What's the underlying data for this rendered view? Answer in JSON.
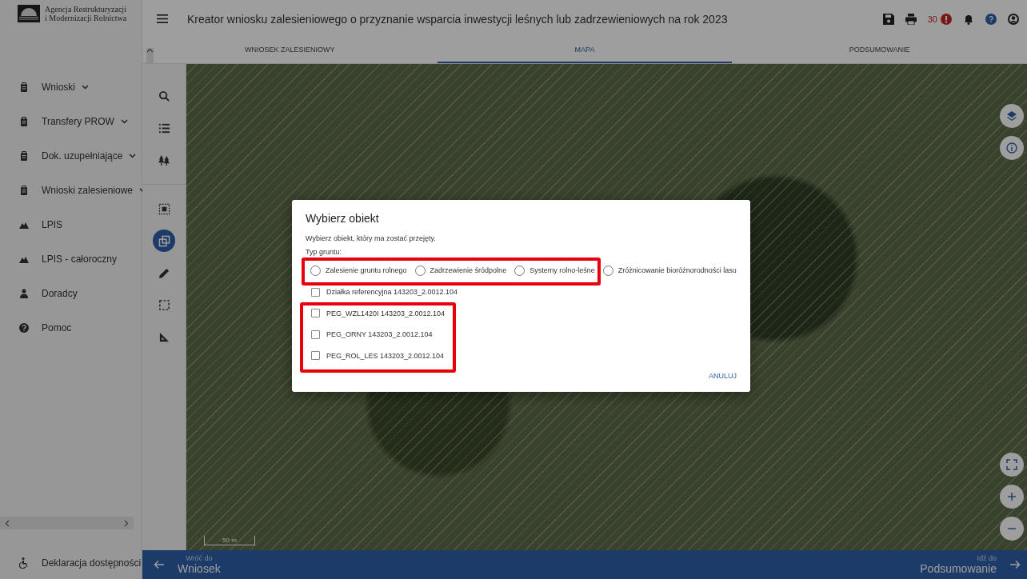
{
  "sidebar": {
    "logo_lines": [
      "Agencja Restrukturyzacji",
      "i Modernizacji Rolnictwa"
    ],
    "items": [
      {
        "label": "Wnioski",
        "kind": "document",
        "expandable": true
      },
      {
        "label": "Transfery PROW",
        "kind": "document",
        "expandable": true
      },
      {
        "label": "Dok. uzupełniające",
        "kind": "document",
        "expandable": true
      },
      {
        "label": "Wnioski zalesieniowe",
        "kind": "document",
        "expandable": true
      },
      {
        "label": "LPIS",
        "kind": "map",
        "expandable": false
      },
      {
        "label": "LPIS - całoroczny",
        "kind": "map",
        "expandable": false
      },
      {
        "label": "Doradcy",
        "kind": "people",
        "expandable": false
      },
      {
        "label": "Pomoc",
        "kind": "help",
        "expandable": false
      }
    ],
    "footer_item": "Deklaracja dostępności"
  },
  "header": {
    "title": "Kreator wniosku zalesieniowego o przyznanie wsparcia inwestycji leśnych lub zadrzewieniowych na rok 2023",
    "alert_count": "30"
  },
  "tabs": [
    {
      "label": "WNIOSEK ZALESIENIOWY",
      "selected": false
    },
    {
      "label": "MAPA",
      "selected": true
    },
    {
      "label": "PODSUMOWANIE",
      "selected": false
    }
  ],
  "tools": [
    {
      "kind": "search",
      "selected": false
    },
    {
      "kind": "list",
      "selected": false
    },
    {
      "kind": "trees",
      "selected": false
    },
    {
      "kind": "dotted-select",
      "selected": false
    },
    {
      "kind": "copy",
      "selected": true
    },
    {
      "kind": "pencil",
      "selected": false
    },
    {
      "kind": "rect-select",
      "selected": false
    },
    {
      "kind": "ruler",
      "selected": false
    }
  ],
  "map": {
    "scale": "50 m"
  },
  "dialog": {
    "title": "Wybierz obiekt",
    "subtitle": "Wybierz obiekt, który ma zostać przejęty.",
    "group_label": "Typ gruntu:",
    "options": [
      {
        "label": "Zalesienie gruntu rolnego",
        "selected": false
      },
      {
        "label": "Zadrzewienie śródpolne",
        "selected": false
      },
      {
        "label": "Systemy rolno-leśne",
        "selected": false
      },
      {
        "label": "Zróżnicowanie bioróżnorodności lasu",
        "selected": false
      }
    ],
    "checkboxes": [
      {
        "label": "Działka referencyjna 143203_2.0012.104",
        "checked": false
      },
      {
        "label": "PEG_WZL1420I 143203_2.0012.104",
        "checked": false
      },
      {
        "label": "PEG_ORNY 143203_2.0012.104",
        "checked": false
      },
      {
        "label": "PEG_ROL_LES 143203_2.0012.104",
        "checked": false
      }
    ],
    "cancel": "ANULUJ"
  },
  "nav": {
    "back_caption": "Wróć do",
    "back_label": "Wniosek",
    "next_caption": "Idź do",
    "next_label": "Podsumowanie"
  }
}
